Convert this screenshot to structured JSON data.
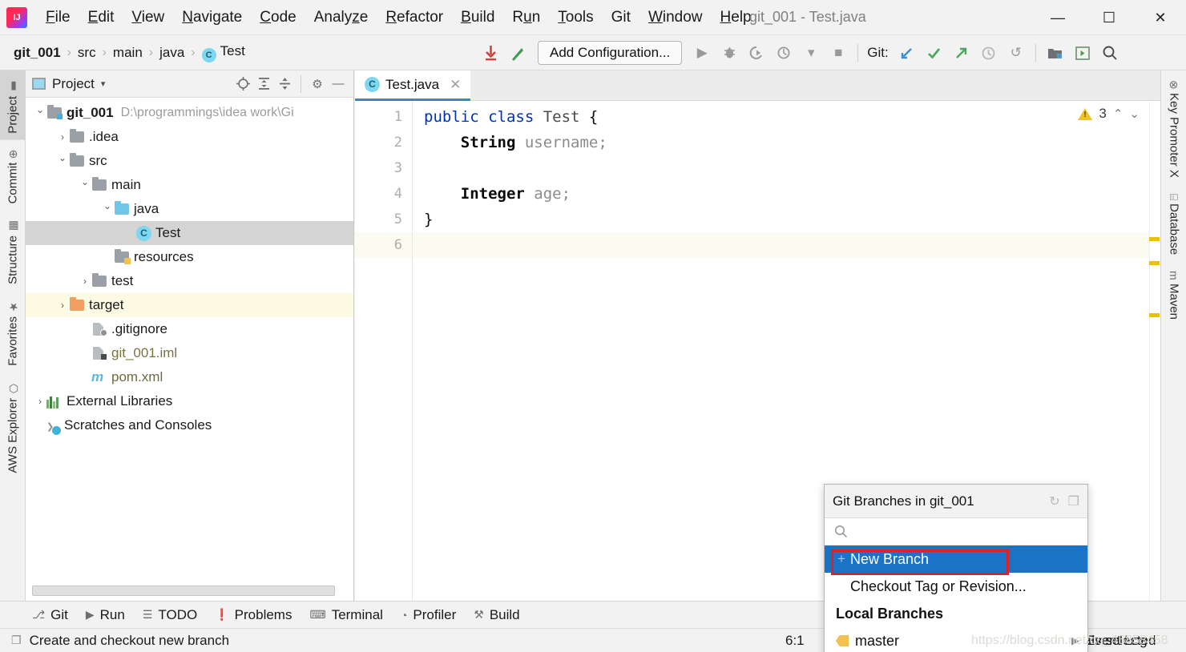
{
  "window": {
    "title": "git_001 - Test.java",
    "minimize": "—",
    "maximize": "☐",
    "close": "✕"
  },
  "menubar": {
    "items": [
      {
        "label": "File",
        "mnemonic": "F"
      },
      {
        "label": "Edit",
        "mnemonic": "E"
      },
      {
        "label": "View",
        "mnemonic": "V"
      },
      {
        "label": "Navigate",
        "mnemonic": "N"
      },
      {
        "label": "Code",
        "mnemonic": "C"
      },
      {
        "label": "Analyze",
        "mnemonic": "z"
      },
      {
        "label": "Refactor",
        "mnemonic": "R"
      },
      {
        "label": "Build",
        "mnemonic": "B"
      },
      {
        "label": "Run",
        "mnemonic": "u"
      },
      {
        "label": "Tools",
        "mnemonic": "T"
      },
      {
        "label": "Git",
        "mnemonic": ""
      },
      {
        "label": "Window",
        "mnemonic": "W"
      },
      {
        "label": "Help",
        "mnemonic": "H"
      }
    ]
  },
  "navbar": {
    "breadcrumbs": [
      "git_001",
      "src",
      "main",
      "java",
      "Test"
    ],
    "separator": "›",
    "class_icon": "C",
    "update_project_icon": "update-project-icon",
    "commit_icon": "commit-icon",
    "run_config_label": "Add Configuration...",
    "run_icon": "▶",
    "debug_icon": "debug-icon",
    "run_coverage_icon": "run-with-coverage-icon",
    "profile_icon": "profile-icon",
    "dropdown_icon": "▾",
    "stop_icon": "■",
    "git_label": "Git:",
    "git_update_icon": "↙",
    "git_commit_icon": "✓",
    "git_push_icon": "↗",
    "git_history_icon": "◴",
    "git_rollback_icon": "↺",
    "project_structure_icon": "project-structure-icon",
    "preview_icon": "▣",
    "search_icon": "⌕"
  },
  "left_strip": [
    {
      "label": "Project",
      "icon": "project-icon",
      "active": true
    },
    {
      "label": "Commit",
      "icon": "commit-icon",
      "active": false
    },
    {
      "label": "Structure",
      "icon": "structure-icon",
      "active": false
    },
    {
      "label": "Favorites",
      "icon": "star-icon",
      "active": false
    },
    {
      "label": "AWS Explorer",
      "icon": "cube-icon",
      "active": false
    }
  ],
  "right_strip": [
    {
      "label": "Key Promoter X",
      "icon": "key-promoter-icon"
    },
    {
      "label": "Database",
      "icon": "database-icon"
    },
    {
      "label": "Maven",
      "icon": "maven-icon"
    }
  ],
  "project_panel": {
    "title": "Project",
    "caret": "▾",
    "tools": {
      "locate_icon": "⊕",
      "expand_icon": "expand-all-icon",
      "collapse_icon": "collapse-all-icon",
      "settings_icon": "⚙",
      "hide_icon": "—"
    },
    "tree": [
      {
        "label": "git_001",
        "path": "D:\\programmings\\idea work\\Gi",
        "indent": 0,
        "arrow": "down",
        "icon": "module-folder",
        "bold": true,
        "state": "normal"
      },
      {
        "label": ".idea",
        "path": "",
        "indent": 1,
        "arrow": "right",
        "icon": "folder-gray",
        "bold": false,
        "state": "normal"
      },
      {
        "label": "src",
        "path": "",
        "indent": 1,
        "arrow": "down",
        "icon": "folder-gray",
        "bold": false,
        "state": "normal"
      },
      {
        "label": "main",
        "path": "",
        "indent": 2,
        "arrow": "down",
        "icon": "folder-gray",
        "bold": false,
        "state": "normal"
      },
      {
        "label": "java",
        "path": "",
        "indent": 3,
        "arrow": "down",
        "icon": "folder-blue",
        "bold": false,
        "state": "normal"
      },
      {
        "label": "Test",
        "path": "",
        "indent": 4,
        "arrow": "none",
        "icon": "class",
        "bold": false,
        "state": "selected"
      },
      {
        "label": "resources",
        "path": "",
        "indent": 3,
        "arrow": "none",
        "icon": "folder-resources",
        "bold": false,
        "state": "normal"
      },
      {
        "label": "test",
        "path": "",
        "indent": 2,
        "arrow": "right",
        "icon": "folder-gray",
        "bold": false,
        "state": "normal"
      },
      {
        "label": "target",
        "path": "",
        "indent": 1,
        "arrow": "right",
        "icon": "folder-orange",
        "bold": false,
        "state": "excluded"
      },
      {
        "label": ".gitignore",
        "path": "",
        "indent": 2,
        "arrow": "none",
        "icon": "file-ignored",
        "bold": false,
        "state": "normal"
      },
      {
        "label": "git_001.iml",
        "path": "",
        "indent": 2,
        "arrow": "none",
        "icon": "file-iml",
        "bold": false,
        "state": "olive"
      },
      {
        "label": "pom.xml",
        "path": "",
        "indent": 2,
        "arrow": "none",
        "icon": "maven-file",
        "bold": false,
        "state": "brown"
      },
      {
        "label": "External Libraries",
        "path": "",
        "indent": 0,
        "arrow": "right",
        "icon": "libraries",
        "bold": false,
        "state": "normal"
      },
      {
        "label": "Scratches and Consoles",
        "path": "",
        "indent": 0,
        "arrow": "none",
        "icon": "scratches",
        "bold": false,
        "state": "normal"
      }
    ]
  },
  "editor": {
    "tab": {
      "label": "Test.java",
      "icon": "C",
      "close": "✕"
    },
    "lines": [
      {
        "num": "1",
        "segments": [
          {
            "text": "public ",
            "cls": "kw"
          },
          {
            "text": "class ",
            "cls": "kw"
          },
          {
            "text": "Test ",
            "cls": "cls"
          },
          {
            "text": "{",
            "cls": "plain"
          }
        ]
      },
      {
        "num": "2",
        "segments": [
          {
            "text": "    ",
            "cls": "plain"
          },
          {
            "text": "String ",
            "cls": "type"
          },
          {
            "text": "username;",
            "cls": "fld"
          }
        ]
      },
      {
        "num": "3",
        "segments": [
          {
            "text": "",
            "cls": "plain"
          }
        ]
      },
      {
        "num": "4",
        "segments": [
          {
            "text": "    ",
            "cls": "plain"
          },
          {
            "text": "Integer ",
            "cls": "type"
          },
          {
            "text": "age;",
            "cls": "fld"
          }
        ]
      },
      {
        "num": "5",
        "segments": [
          {
            "text": "}",
            "cls": "plain"
          }
        ]
      },
      {
        "num": "6",
        "segments": [
          {
            "text": "",
            "cls": "plain"
          }
        ],
        "current": true
      }
    ],
    "inspection": {
      "warning_count": "3",
      "warning_icon": "warning-triangle-icon",
      "prev_icon": "⌃",
      "next_icon": "⌄"
    },
    "markers": [
      170,
      200,
      265
    ]
  },
  "git_popup": {
    "title": "Git Branches in git_001",
    "refresh_icon": "↻",
    "restore_icon": "❐",
    "search_icon": "⌕",
    "search_placeholder": "",
    "items": [
      {
        "label": "New Branch",
        "selected": true,
        "icon": "plus-icon"
      },
      {
        "label": "Checkout Tag or Revision...",
        "selected": false,
        "icon": "none"
      }
    ],
    "group_label": "Local Branches",
    "branches": [
      {
        "label": "master",
        "icon": "tag-icon",
        "arrow": "▶"
      }
    ]
  },
  "toolwindow_bar": [
    {
      "label": "Git",
      "icon": "git-branch-icon"
    },
    {
      "label": "Run",
      "icon": "▶"
    },
    {
      "label": "TODO",
      "icon": "☰"
    },
    {
      "label": "Problems",
      "icon": "❗"
    },
    {
      "label": "Terminal",
      "icon": "⌨"
    },
    {
      "label": "Profiler",
      "icon": "profiler-icon"
    },
    {
      "label": "Build",
      "icon": "hammer-icon"
    }
  ],
  "statusbar": {
    "icon": "❐",
    "message": "Create and checkout new branch",
    "cursor_position": "6:1",
    "event_log": "Event Log",
    "credentials": "ials selected"
  },
  "watermark": "https://blog.csdn.net/qq_45858458"
}
